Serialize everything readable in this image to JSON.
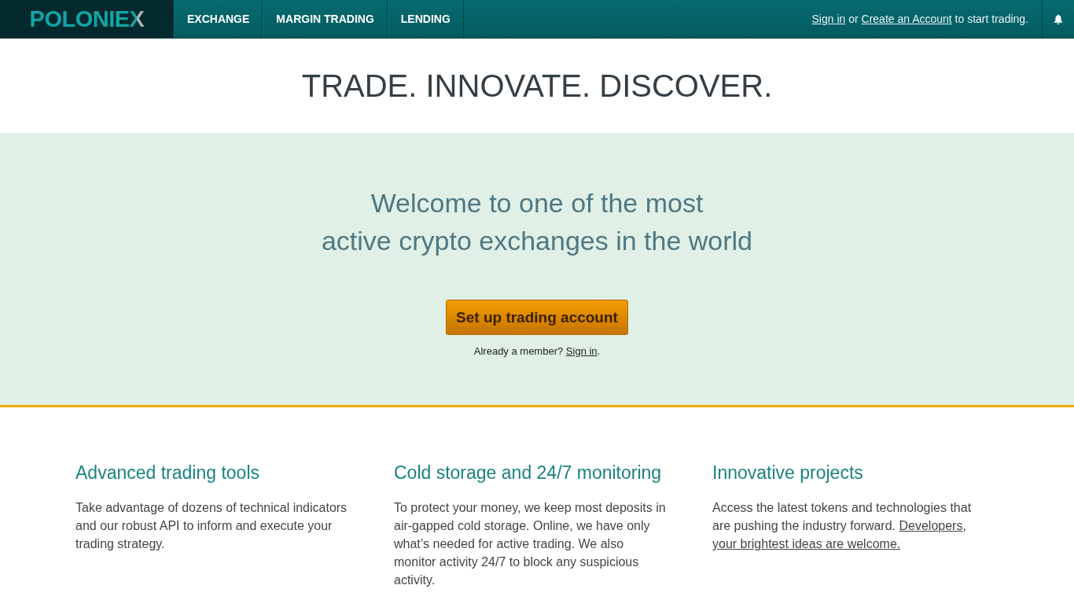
{
  "header": {
    "logo": "POLONIEX",
    "nav": [
      {
        "label": "EXCHANGE"
      },
      {
        "label": "MARGIN TRADING"
      },
      {
        "label": "LENDING"
      }
    ],
    "account_prompt": [
      {
        "kind": "link",
        "text": "Sign in"
      },
      {
        "kind": "text",
        "text": " or "
      },
      {
        "kind": "link",
        "text": "Create an Account"
      },
      {
        "kind": "text",
        "text": " to start trading."
      }
    ]
  },
  "tagline": "TRADE. INNOVATE. DISCOVER.",
  "hero": {
    "headline_lines": [
      "Welcome to one of the most",
      "active crypto exchanges in the world"
    ],
    "cta_button": "Set up trading account",
    "member_prompt": [
      {
        "kind": "text",
        "text": "Already a member? "
      },
      {
        "kind": "link",
        "text": "Sign in"
      },
      {
        "kind": "text",
        "text": "."
      }
    ]
  },
  "features": [
    {
      "title": "Advanced trading tools",
      "text": [
        {
          "kind": "text",
          "text": "Take advantage of dozens of technical indicators and our robust API to inform and execute your trading strategy."
        }
      ]
    },
    {
      "title": "Cold storage and 24/7 monitoring",
      "text": [
        {
          "kind": "text",
          "text": "To protect your money, we keep most deposits in air-gapped cold storage. Online, we have only what’s needed for active trading. We also monitor activity 24/7 to block any suspicious activity."
        }
      ]
    },
    {
      "title": "Innovative projects",
      "text": [
        {
          "kind": "text",
          "text": "Access the latest tokens and technologies that are pushing the industry forward. "
        },
        {
          "kind": "link",
          "text": "Developers"
        },
        {
          "kind": "text",
          "text": ", "
        },
        {
          "kind": "link",
          "text": "your brightest ideas are welcome."
        }
      ]
    }
  ]
}
